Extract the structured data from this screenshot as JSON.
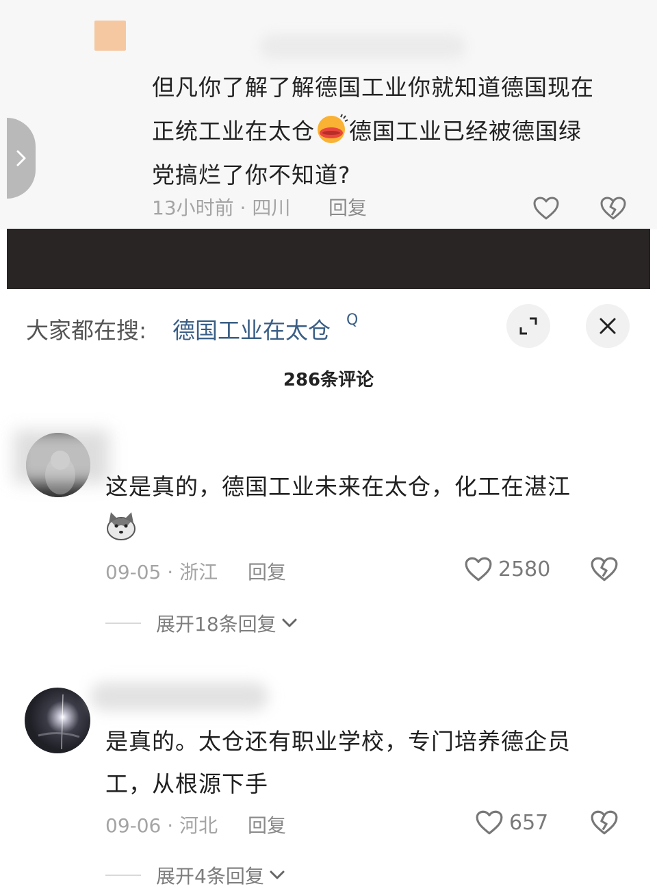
{
  "top_comment": {
    "text_line1": "但凡你了解了解德国工业你就知道德国现在",
    "text_line2a": "正统工业在太仓",
    "text_line2b": "德国工业已经被德国绿",
    "text_line3": "党搞烂了你不知道?",
    "meta": "13小时前 · 四川",
    "reply_label": "回复"
  },
  "search_bar": {
    "prefix": "大家都在搜:",
    "term": "德国工业在太仓",
    "glyph": "Q"
  },
  "comments_header": {
    "title": "286条评论"
  },
  "comments": [
    {
      "text_line1": "这是真的，德国工业未来在太仓，化工在湛江",
      "meta": "09-05 · 浙江",
      "reply_label": "回复",
      "likes": "2580",
      "expand_label": "展开18条回复"
    },
    {
      "text_line1": "是真的。太仓还有职业学校，专门培养德企员",
      "text_line2": "工，从根源下手",
      "meta": "09-06 · 河北",
      "reply_label": "回复",
      "likes": "657",
      "expand_label": "展开4条回复"
    }
  ],
  "icons": {
    "like": "heart-outline-icon",
    "dislike": "broken-heart-icon",
    "expand": "expand-arrows-icon",
    "close": "close-icon",
    "chevron": "chevron-down-icon",
    "side": "chevron-right-icon"
  },
  "colors": {
    "link_blue": "#3a5e86",
    "meta_gray": "#a4a4a4",
    "band_dark": "#2a2525"
  }
}
